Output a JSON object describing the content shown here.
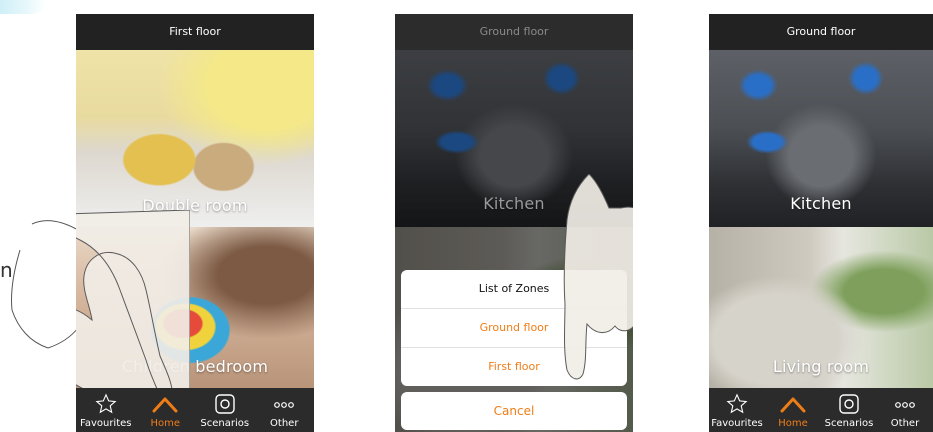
{
  "side_text": "n",
  "screen1": {
    "header": "First floor",
    "tiles": [
      {
        "label": "Double room"
      },
      {
        "label": "Children bedroom"
      }
    ],
    "nav": [
      {
        "label": "Favourites",
        "icon": "star-icon"
      },
      {
        "label": "Home",
        "icon": "home-icon"
      },
      {
        "label": "Scenarios",
        "icon": "scenarios-icon"
      },
      {
        "label": "Other",
        "icon": "more-icon"
      }
    ],
    "active_nav": "Home"
  },
  "screen2": {
    "header": "Ground floor",
    "tiles": [
      {
        "label": "Kitchen"
      }
    ],
    "popup": {
      "title": "List of Zones",
      "options": [
        "Ground floor",
        "First floor"
      ],
      "cancel": "Cancel"
    }
  },
  "screen3": {
    "header": "Ground floor",
    "tiles": [
      {
        "label": "Kitchen"
      },
      {
        "label": "Living room"
      }
    ],
    "nav": [
      {
        "label": "Favourites",
        "icon": "star-icon"
      },
      {
        "label": "Home",
        "icon": "home-icon"
      },
      {
        "label": "Scenarios",
        "icon": "scenarios-icon"
      },
      {
        "label": "Other",
        "icon": "more-icon"
      }
    ],
    "active_nav": "Home"
  },
  "colors": {
    "accent": "#ef7d17",
    "header_bg": "#222222",
    "nav_bg": "#2b2b2b"
  }
}
